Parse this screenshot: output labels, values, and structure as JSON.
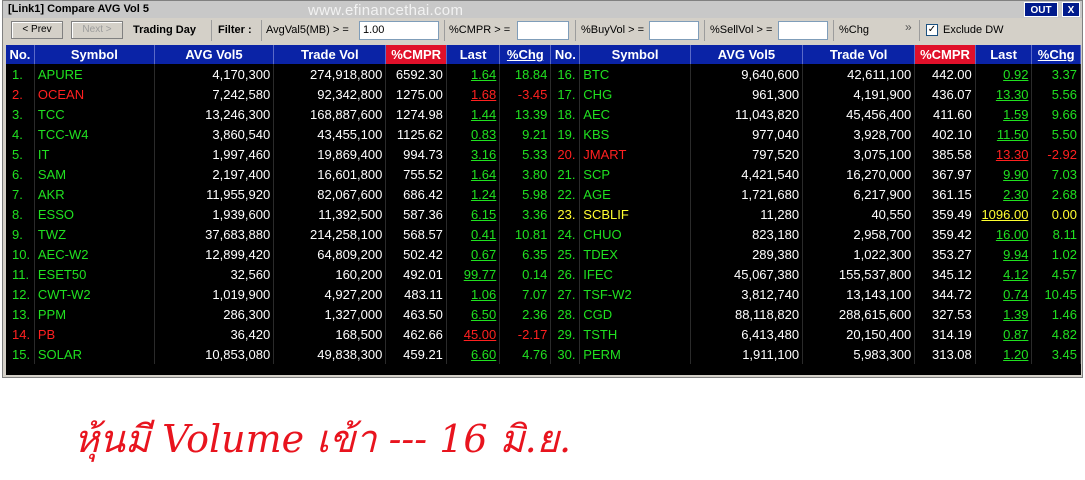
{
  "window": {
    "title": "[Link1] Compare AVG Vol 5",
    "watermark": "www.efinancethai.com",
    "out_label": "OUT",
    "close_label": "X"
  },
  "toolbar": {
    "prev_label": "< Prev",
    "next_label": "Next >",
    "trading_day_label": "Trading Day",
    "filter_label": "Filter :",
    "avgvol_label": "AvgVal5(MB) > =",
    "avgvol_value": "1.00",
    "cmpr_label": "%CMPR > =",
    "cmpr_value": "",
    "buyvol_label": "%BuyVol > =",
    "buyvol_value": "",
    "sellvol_label": "%SellVol > =",
    "sellvol_value": "",
    "chg_label": "%Chg",
    "more_label": "»",
    "exclude_dw_label": "Exclude DW",
    "exclude_dw_checked": "✓"
  },
  "columns": [
    "No.",
    "Symbol",
    "AVG Vol5",
    "Trade Vol",
    "%CMPR",
    "Last",
    "%Chg"
  ],
  "colors": {
    "up": "#20e020",
    "down": "#ff2020",
    "unchanged": "#ffff30"
  },
  "left_rows": [
    {
      "no": "1.",
      "symbol": "APURE",
      "avg": "4,170,300",
      "trade": "274,918,800",
      "cmpr": "6592.30",
      "last": "1.64",
      "chg": "18.84",
      "dir": "up"
    },
    {
      "no": "2.",
      "symbol": "OCEAN",
      "avg": "7,242,580",
      "trade": "92,342,800",
      "cmpr": "1275.00",
      "last": "1.68",
      "chg": "-3.45",
      "dir": "down"
    },
    {
      "no": "3.",
      "symbol": "TCC",
      "avg": "13,246,300",
      "trade": "168,887,600",
      "cmpr": "1274.98",
      "last": "1.44",
      "chg": "13.39",
      "dir": "up"
    },
    {
      "no": "4.",
      "symbol": "TCC-W4",
      "avg": "3,860,540",
      "trade": "43,455,100",
      "cmpr": "1125.62",
      "last": "0.83",
      "chg": "9.21",
      "dir": "up"
    },
    {
      "no": "5.",
      "symbol": "IT",
      "avg": "1,997,460",
      "trade": "19,869,400",
      "cmpr": "994.73",
      "last": "3.16",
      "chg": "5.33",
      "dir": "up"
    },
    {
      "no": "6.",
      "symbol": "SAM",
      "avg": "2,197,400",
      "trade": "16,601,800",
      "cmpr": "755.52",
      "last": "1.64",
      "chg": "3.80",
      "dir": "up"
    },
    {
      "no": "7.",
      "symbol": "AKR",
      "avg": "11,955,920",
      "trade": "82,067,600",
      "cmpr": "686.42",
      "last": "1.24",
      "chg": "5.98",
      "dir": "up"
    },
    {
      "no": "8.",
      "symbol": "ESSO",
      "avg": "1,939,600",
      "trade": "11,392,500",
      "cmpr": "587.36",
      "last": "6.15",
      "chg": "3.36",
      "dir": "up"
    },
    {
      "no": "9.",
      "symbol": "TWZ",
      "avg": "37,683,880",
      "trade": "214,258,100",
      "cmpr": "568.57",
      "last": "0.41",
      "chg": "10.81",
      "dir": "up"
    },
    {
      "no": "10.",
      "symbol": "AEC-W2",
      "avg": "12,899,420",
      "trade": "64,809,200",
      "cmpr": "502.42",
      "last": "0.67",
      "chg": "6.35",
      "dir": "up"
    },
    {
      "no": "11.",
      "symbol": "ESET50",
      "avg": "32,560",
      "trade": "160,200",
      "cmpr": "492.01",
      "last": "99.77",
      "chg": "0.14",
      "dir": "up"
    },
    {
      "no": "12.",
      "symbol": "CWT-W2",
      "avg": "1,019,900",
      "trade": "4,927,200",
      "cmpr": "483.11",
      "last": "1.06",
      "chg": "7.07",
      "dir": "up"
    },
    {
      "no": "13.",
      "symbol": "PPM",
      "avg": "286,300",
      "trade": "1,327,000",
      "cmpr": "463.50",
      "last": "6.50",
      "chg": "2.36",
      "dir": "up"
    },
    {
      "no": "14.",
      "symbol": "PB",
      "avg": "36,420",
      "trade": "168,500",
      "cmpr": "462.66",
      "last": "45.00",
      "chg": "-2.17",
      "dir": "down"
    },
    {
      "no": "15.",
      "symbol": "SOLAR",
      "avg": "10,853,080",
      "trade": "49,838,300",
      "cmpr": "459.21",
      "last": "6.60",
      "chg": "4.76",
      "dir": "up"
    }
  ],
  "right_rows": [
    {
      "no": "16.",
      "symbol": "BTC",
      "avg": "9,640,600",
      "trade": "42,611,100",
      "cmpr": "442.00",
      "last": "0.92",
      "chg": "3.37",
      "dir": "up"
    },
    {
      "no": "17.",
      "symbol": "CHG",
      "avg": "961,300",
      "trade": "4,191,900",
      "cmpr": "436.07",
      "last": "13.30",
      "chg": "5.56",
      "dir": "up"
    },
    {
      "no": "18.",
      "symbol": "AEC",
      "avg": "11,043,820",
      "trade": "45,456,400",
      "cmpr": "411.60",
      "last": "1.59",
      "chg": "9.66",
      "dir": "up"
    },
    {
      "no": "19.",
      "symbol": "KBS",
      "avg": "977,040",
      "trade": "3,928,700",
      "cmpr": "402.10",
      "last": "11.50",
      "chg": "5.50",
      "dir": "up"
    },
    {
      "no": "20.",
      "symbol": "JMART",
      "avg": "797,520",
      "trade": "3,075,100",
      "cmpr": "385.58",
      "last": "13.30",
      "chg": "-2.92",
      "dir": "down"
    },
    {
      "no": "21.",
      "symbol": "SCP",
      "avg": "4,421,540",
      "trade": "16,270,000",
      "cmpr": "367.97",
      "last": "9.90",
      "chg": "7.03",
      "dir": "up"
    },
    {
      "no": "22.",
      "symbol": "AGE",
      "avg": "1,721,680",
      "trade": "6,217,900",
      "cmpr": "361.15",
      "last": "2.30",
      "chg": "2.68",
      "dir": "up"
    },
    {
      "no": "23.",
      "symbol": "SCBLIF",
      "avg": "11,280",
      "trade": "40,550",
      "cmpr": "359.49",
      "last": "1096.00",
      "chg": "0.00",
      "dir": "unchanged"
    },
    {
      "no": "24.",
      "symbol": "CHUO",
      "avg": "823,180",
      "trade": "2,958,700",
      "cmpr": "359.42",
      "last": "16.00",
      "chg": "8.11",
      "dir": "up"
    },
    {
      "no": "25.",
      "symbol": "TDEX",
      "avg": "289,380",
      "trade": "1,022,300",
      "cmpr": "353.27",
      "last": "9.94",
      "chg": "1.02",
      "dir": "up"
    },
    {
      "no": "26.",
      "symbol": "IFEC",
      "avg": "45,067,380",
      "trade": "155,537,800",
      "cmpr": "345.12",
      "last": "4.12",
      "chg": "4.57",
      "dir": "up"
    },
    {
      "no": "27.",
      "symbol": "TSF-W2",
      "avg": "3,812,740",
      "trade": "13,143,100",
      "cmpr": "344.72",
      "last": "0.74",
      "chg": "10.45",
      "dir": "up"
    },
    {
      "no": "28.",
      "symbol": "CGD",
      "avg": "88,118,820",
      "trade": "288,615,600",
      "cmpr": "327.53",
      "last": "1.39",
      "chg": "1.46",
      "dir": "up"
    },
    {
      "no": "29.",
      "symbol": "TSTH",
      "avg": "6,413,480",
      "trade": "20,150,400",
      "cmpr": "314.19",
      "last": "0.87",
      "chg": "4.82",
      "dir": "up"
    },
    {
      "no": "30.",
      "symbol": "PERM",
      "avg": "1,911,100",
      "trade": "5,983,300",
      "cmpr": "313.08",
      "last": "1.20",
      "chg": "3.45",
      "dir": "up"
    }
  ],
  "caption": "หุ้นมี Volume เข้า --- 16 มิ.ย."
}
